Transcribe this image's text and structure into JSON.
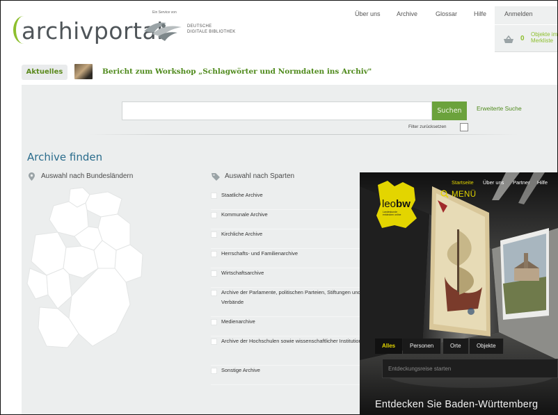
{
  "brand": {
    "logo_word": "archivportal",
    "service_line": "Ein Service von",
    "ddb_line1": "DEUTSCHE",
    "ddb_line2": "DIGITALE BIBLIOTHEK"
  },
  "topnav": [
    "Über uns",
    "Archive",
    "Glossar",
    "Hilfe"
  ],
  "account": {
    "login": "Anmelden",
    "basket_count": "0",
    "basket_line1": "Objekte im",
    "basket_line2": "Merkliste"
  },
  "news": {
    "tag": "Aktuelles",
    "title": "Bericht zum Workshop „Schlagwörter und Normdaten ins Archiv\""
  },
  "search": {
    "button": "Suchen",
    "advanced": "Erweiterte Suche",
    "reset": "Filter zurücksetzen"
  },
  "archive": {
    "heading": "Archive finden",
    "by_state": "Auswahl nach Bundesländern",
    "by_sparte": "Auswahl nach Sparten",
    "sparten": [
      "Staatliche Archive",
      "Kommunale Archive",
      "Kirchliche Archive",
      "Herrschafts- und Familienarchive",
      "Wirtschaftsarchive",
      "Archive der Parlamente, politischen Parteien, Stiftungen und Verbände",
      "Medienarchive",
      "Archive der Hochschulen sowie wissenschaftlicher Institutionen",
      "Sonstige Archive"
    ]
  },
  "leo": {
    "nav": [
      "Startseite",
      "Über uns",
      "Partner",
      "Hilfe"
    ],
    "menu": "MENÜ",
    "logo_light": "leo",
    "logo_bold": "bw",
    "logo_sub1": "Landeskunde",
    "logo_sub2": "entdecken online",
    "tabs": [
      "Alles",
      "Personen",
      "Orte",
      "Objekte"
    ],
    "search_placeholder": "Entdeckungsreise starten",
    "tagline": "Entdecken Sie Baden-Württemberg"
  },
  "colors": {
    "archiv_green": "#6ba23c",
    "archiv_blue": "#2a6c8c",
    "leo_yellow": "#e3d500"
  }
}
